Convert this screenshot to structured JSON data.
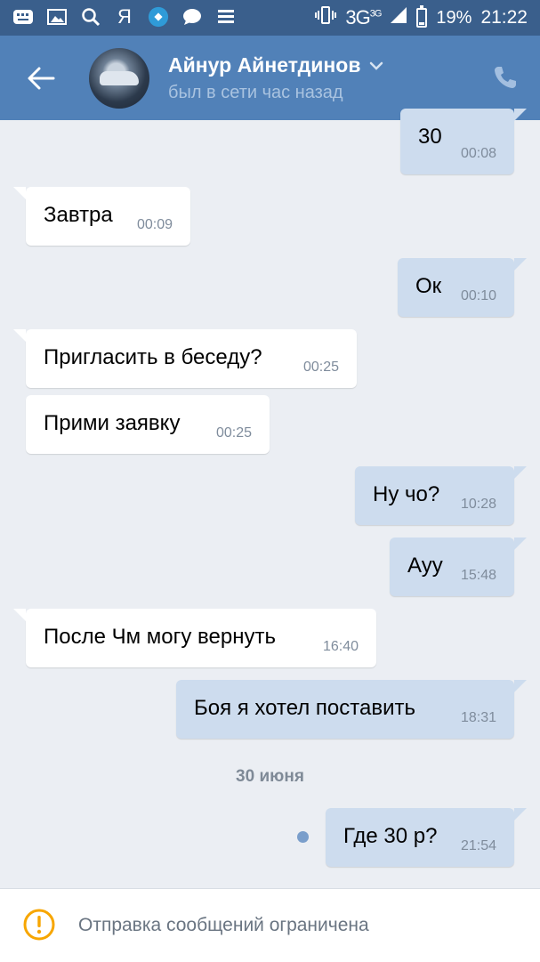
{
  "status_bar": {
    "yandex_glyph": "Я",
    "network": "3G",
    "network_sup": "3G",
    "battery": "19%",
    "battery_level": 0.19,
    "time": "21:22"
  },
  "header": {
    "contact_name": "Айнур Айнетдинов",
    "contact_status": "был в сети час назад"
  },
  "messages": [
    {
      "text": "30",
      "time": "00:08",
      "direction": "out"
    },
    {
      "text": "Завтра",
      "time": "00:09",
      "direction": "in"
    },
    {
      "text": "Ок",
      "time": "00:10",
      "direction": "out"
    },
    {
      "text": "Пригласить в беседу?",
      "time": "00:25",
      "direction": "in"
    },
    {
      "text": "Прими заявку",
      "time": "00:25",
      "direction": "in"
    },
    {
      "text": "Ну чо?",
      "time": "10:28",
      "direction": "out"
    },
    {
      "text": "Ауу",
      "time": "15:48",
      "direction": "out"
    },
    {
      "text": "После Чм могу вернуть",
      "time": "16:40",
      "direction": "in"
    },
    {
      "text": "Боя я хотел поставить",
      "time": "18:31",
      "direction": "out"
    },
    {
      "text": "Где 30 р?",
      "time": "21:54",
      "direction": "out",
      "unread": true
    }
  ],
  "date_separator": "30 июня",
  "footer": {
    "restriction_text": "Отправка сообщений ограничена"
  },
  "colors": {
    "header": "#5181b8",
    "status_bar": "#3a5f8c",
    "background": "#ebeef3",
    "outgoing_bubble": "#cddcee",
    "incoming_bubble": "#ffffff",
    "warning": "#f7a600"
  }
}
